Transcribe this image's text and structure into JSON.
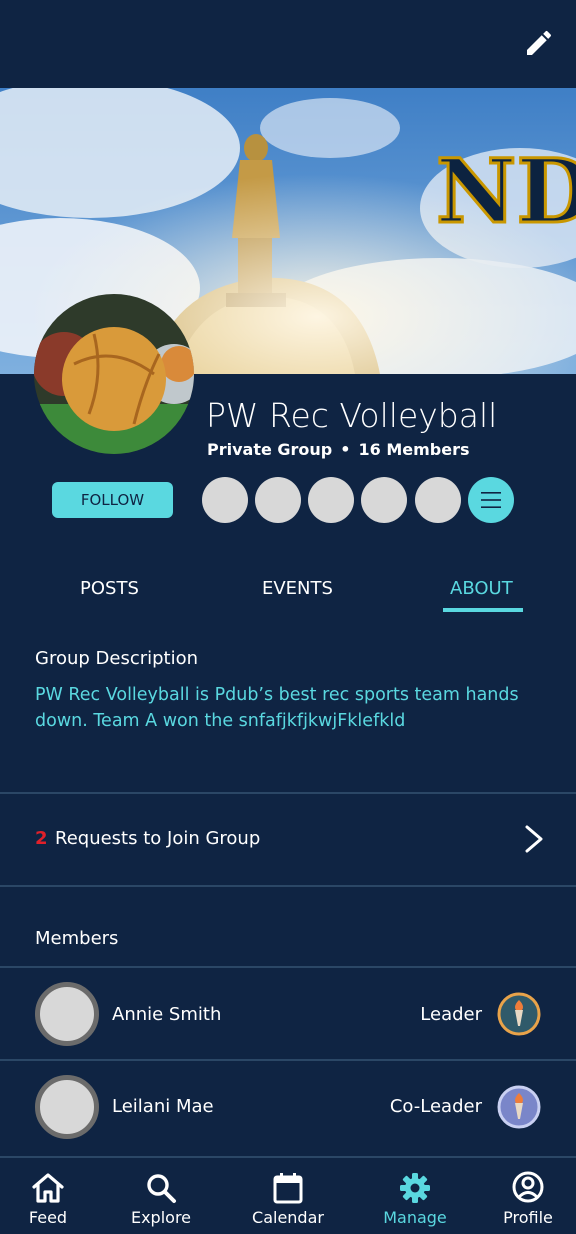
{
  "header": {
    "edit_icon": "pencil-icon"
  },
  "group": {
    "name": "PW Rec Volleyball",
    "privacy": "Private Group",
    "separator": "•",
    "member_count": "16 Members",
    "follow_label": "FOLLOW",
    "banner_logo_alt": "ND",
    "member_preview_count": 5,
    "more_icon": "menu-icon"
  },
  "tabs": [
    {
      "label": "POSTS"
    },
    {
      "label": "EVENTS"
    },
    {
      "label": "ABOUT"
    }
  ],
  "about": {
    "description_title": "Group Description",
    "description_text": "PW Rec Volleyball is Pdub’s best rec sports team hands down. Team A won the snfafjkfjkwjFklefkld"
  },
  "requests": {
    "count": "2",
    "label": "Requests to Join Group",
    "chevron_icon": "chevron-right-icon"
  },
  "members": {
    "title": "Members",
    "items": [
      {
        "name": "Annie Smith",
        "role": "Leader",
        "badge_icon": "torch-badge-icon"
      },
      {
        "name": "Leilani Mae",
        "role": "Co-Leader",
        "badge_icon": "torch-badge-icon"
      }
    ]
  },
  "nav": {
    "items": [
      {
        "label": "Feed",
        "icon": "home-icon"
      },
      {
        "label": "Explore",
        "icon": "search-icon"
      },
      {
        "label": "Calendar",
        "icon": "calendar-icon"
      },
      {
        "label": "Manage",
        "icon": "gear-icon",
        "active": true
      },
      {
        "label": "Profile",
        "icon": "profile-icon"
      }
    ]
  },
  "colors": {
    "background": "#0f2443",
    "accent": "#5ad8e0",
    "alert": "#e0202a",
    "divider": "#2b4766"
  }
}
